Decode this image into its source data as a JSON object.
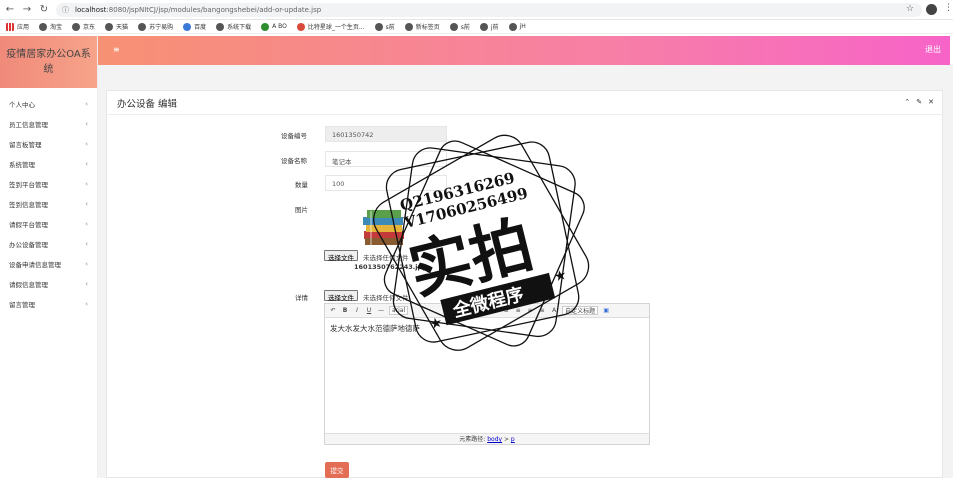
{
  "browser": {
    "url_host": "localhost",
    "url_path": ":8080/jspNItCJ/jsp/modules/bangongshebei/add-or-update.jsp",
    "bookmarks": [
      "应用",
      "淘宝",
      "京东",
      "天猫",
      "苏宁易购",
      "百度",
      "系统下载",
      "A BO",
      "比特星球_一个生页...",
      "s前",
      "新标签页",
      "s前",
      "j前",
      "jH"
    ]
  },
  "sidebar": {
    "brand": "疫情居家办公OA系统",
    "items": [
      "个人中心",
      "员工信息管理",
      "留言板管理",
      "系统管理",
      "签到平台管理",
      "签到信息管理",
      "请假平台管理",
      "办公设备管理",
      "设备申请信息管理",
      "请假信息管理",
      "留言管理"
    ]
  },
  "topbar": {
    "menu_icon": "≡",
    "logout": "退出"
  },
  "panel": {
    "title": "办公设备 编辑"
  },
  "form": {
    "code_label": "设备编号",
    "code_value": "1601350742",
    "name_label": "设备名称",
    "name_value": "笔记本",
    "qty_label": "数量",
    "qty_value": "100",
    "image_label": "图片",
    "file_button": "选择文件",
    "file_none": "未选择任何文件",
    "file_name": "1601350762243.jpg",
    "detail_label": "详情",
    "detail_file_button": "选择文件",
    "detail_file_none": "未选择任何文件",
    "editor_font": "arial",
    "editor_custom": "自定义标题",
    "editor_content": "发大水发大水范德萨地德萨",
    "editor_path_label": "元素路径:",
    "editor_path_body": "body",
    "editor_path_sep": " > ",
    "editor_path_p": "p",
    "submit": "提交"
  },
  "watermark": {
    "line1": "Q2196316269",
    "line2": "V17060256499",
    "big": "实拍",
    "ribbon": "全微程序"
  },
  "colors": {
    "topbar_start": "#f79173",
    "topbar_end": "#f763c8",
    "submit": "#e46e55"
  }
}
